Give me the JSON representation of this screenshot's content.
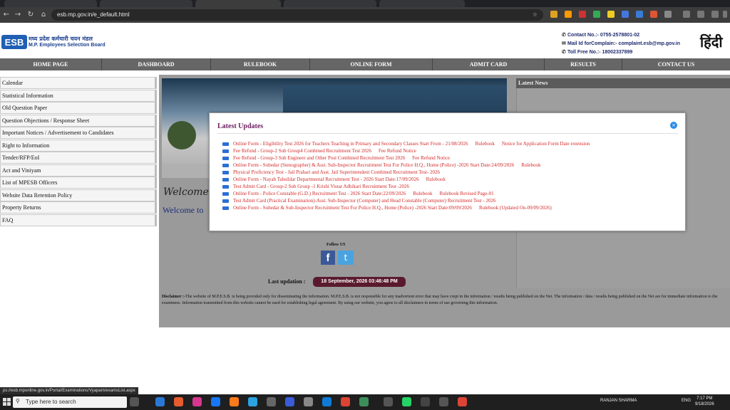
{
  "browser": {
    "tabs": [
      "",
      "",
      "",
      "",
      ""
    ],
    "url": "esb.mp.gov.in/e_default.html"
  },
  "header": {
    "logo_mark": "ESB",
    "logo_hindi": "मध्य प्रदेश कर्मचारी चयन मंडल",
    "logo_english": "M.P. Employees Selection Board",
    "contact_no": "Contact No.:- 0755-2578801-02",
    "mail": "Mail Id forComplain:- complaint.esb@mp.gov.in",
    "toll_free": "Toll Free No.:- 18002337899",
    "hindi_link": "हिंदी"
  },
  "menu": [
    "HOME PAGE",
    "DASHBOARD",
    "RULEBOOK",
    "ONLINE FORM",
    "ADMIT CARD",
    "RESULTS",
    "CONTACT US"
  ],
  "sidebar": [
    "Calendar",
    "Statistical Information",
    "Old Question Paper",
    "Question Objections / Response Sheet",
    "Important Notices / Advertisement to Candidates",
    "Right to Information",
    "Tender/RFP/EoI",
    "Act and Viniyam",
    "List of MPESB Officers",
    "Website Data Retention Policy",
    "Property Returns",
    "FAQ"
  ],
  "main": {
    "welcome_script": "Welcome",
    "welcome_text": "Welcome to",
    "latest_news_title": "Latest News",
    "follow_us": "Follow US",
    "facebook_glyph": "f",
    "twitter_glyph": "t",
    "last_updation_label": "Last updation :",
    "last_updation_value": "18 September, 2026 03:46:48 PM",
    "disclaimer_label": "Disclaimer :-",
    "disclaimer_text": "The website of M.P.E.S.B. is being provided only for disseminating the information. M.P.E.S.B. is not responsible for any inadvertent error that may have crept in the information / results being published on the Net. The information / data / results being published on the Net are for immediate information to the examinees. Information transmitted from this website cannot be used for establishing legal agreement. By using our website, you agree to all disclaimers in terms of use governing this information."
  },
  "modal": {
    "title": "Latest Updates",
    "close_glyph": "×",
    "updates": [
      {
        "text": "Online Form - Eligibility Test 2026 for Teachers Teaching in Primary and Secondary Classes Start From - 21/08/2026",
        "links": [
          "Rulebook",
          "Notice for Application Form Date extension"
        ]
      },
      {
        "text": "Fee Refund - Group-2 Sub Group4 Combined Recruitment Test 2026",
        "links": [
          "Fee Refund Notice"
        ]
      },
      {
        "text": "Fee Refund - Group-3 Sub Engineer and Other Post Combined Recruitment Test 2026",
        "links": [
          "Fee Refund Notice"
        ]
      },
      {
        "text": "Online Form - Subedar (Stenographer) & Asst. Sub-Inspector Recruitment Test For Police H.Q., Home (Police) -2026 Start Date:24/09/2026",
        "links": [
          "Rulebook"
        ]
      },
      {
        "text": "Physical Proficiency Test - Jail Prahari and Asst. Jail Superintendent Combined Recruitment Test- 2026",
        "links": []
      },
      {
        "text": "Online Form - Nayab Tahsildar Departmental Recruitment Test - 2026 Start Date:17/09/2026",
        "links": [
          "Rulebook"
        ]
      },
      {
        "text": "Test Admit Card - Group-2 Sub Group -1 Krishi Vistar Adhikari Recruitment Test -2026",
        "links": []
      },
      {
        "text": "Online Form - Police Constable (G.D.) Recruitment Test - 2026 Start Date:22/09/2026",
        "links": [
          "Rulebook",
          "Rulebook Revised Page-01"
        ]
      },
      {
        "text": "Test Admit Card (Practical Examination)-Asst. Sub-Inspector (Computer) and Head Constable (Computer) Recruitment Test - 2026",
        "links": []
      },
      {
        "text": "Online Form - Subedar & Sub-Inspector Recruitment Test For Police H.Q., Home (Police) -2026 Start Date:09/09/2026",
        "links": [
          "Rulebook (Updated On-09/09/2026)"
        ]
      }
    ]
  },
  "status_url": "ps://esb.mponline.gov.in/Portal/Examinations/Vyapam/examsList.aspx",
  "taskbar": {
    "search_placeholder": "Type here to search",
    "user": "RANJAN SHARMA",
    "lang": "ENG",
    "time": "7:17 PM",
    "date": "9/18/2026"
  }
}
